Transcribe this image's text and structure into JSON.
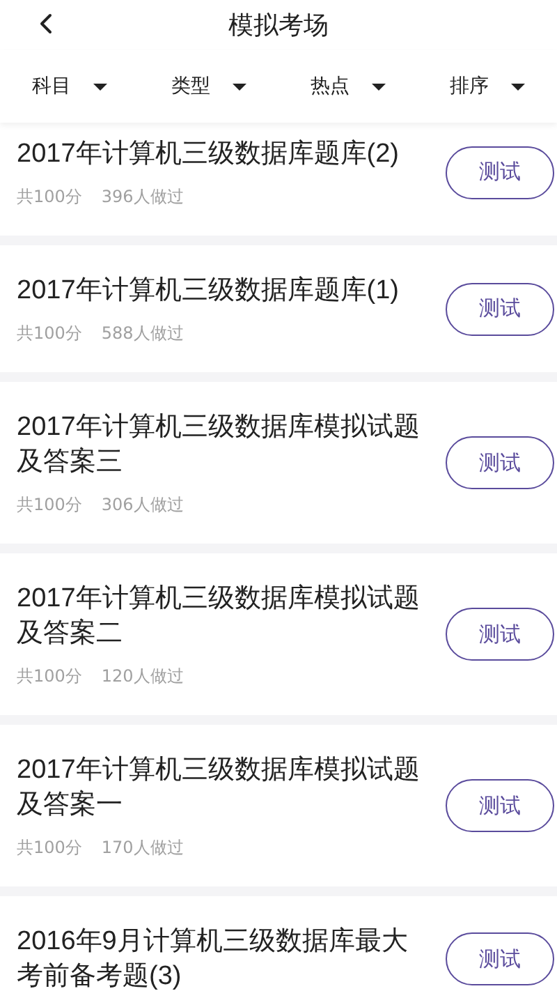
{
  "header": {
    "title": "模拟考场"
  },
  "filters": [
    {
      "label": "科目"
    },
    {
      "label": "类型"
    },
    {
      "label": "热点"
    },
    {
      "label": "排序"
    }
  ],
  "exams": [
    {
      "title": "2017年计算机三级数据库题库(2)",
      "score": "共100分",
      "attempts": "396人做过",
      "button": "测试"
    },
    {
      "title": "2017年计算机三级数据库题库(1)",
      "score": "共100分",
      "attempts": "588人做过",
      "button": "测试"
    },
    {
      "title": "2017年计算机三级数据库模拟试题及答案三",
      "score": "共100分",
      "attempts": "306人做过",
      "button": "测试"
    },
    {
      "title": "2017年计算机三级数据库模拟试题及答案二",
      "score": "共100分",
      "attempts": "120人做过",
      "button": "测试"
    },
    {
      "title": "2017年计算机三级数据库模拟试题及答案一",
      "score": "共100分",
      "attempts": "170人做过",
      "button": "测试"
    },
    {
      "title": "2016年9月计算机三级数据库最大考前备考题(3)",
      "button": "测试"
    }
  ]
}
